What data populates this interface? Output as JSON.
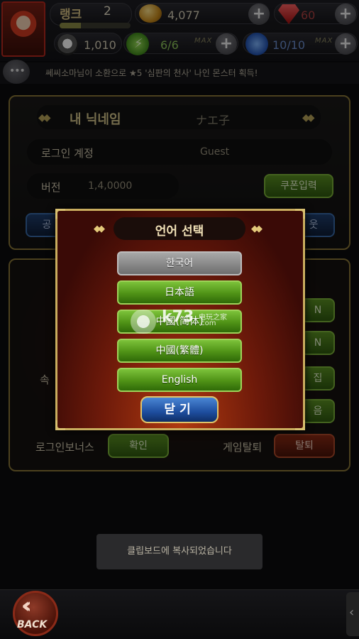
{
  "hud": {
    "rank_label": "랭크",
    "rank_value": "2",
    "xp_fraction": 0.3,
    "gold": "4,077",
    "gems": "60",
    "pet_count": "1,010",
    "energy": "6/6",
    "feathers": "10/10",
    "max_tag": "MAX",
    "plus": "+"
  },
  "ticker": {
    "text": "쎄씨소마님이 소환으로 ★5 '심판의 천사' 나인 몬스터 획득!"
  },
  "profile": {
    "nickname_label": "내 닉네임",
    "nickname_value": "ナエ子",
    "login_label": "로그인 계정",
    "login_value": "Guest",
    "version_label": "버전",
    "version_value": "1,4,0000",
    "coupon_button": "쿠폰입력",
    "left_partial_button": "공",
    "right_partial_button": "웃"
  },
  "settings": {
    "right_btn_1": "N",
    "right_btn_2": "N",
    "right_btn_3": "집",
    "right_btn_4": "음",
    "left_partial_label": "속",
    "login_bonus_label": "로그인보너스",
    "login_bonus_button": "확인",
    "withdraw_label": "게임탈퇴",
    "withdraw_button": "탈퇴"
  },
  "modal": {
    "title": "언어 선택",
    "languages": [
      {
        "label": "한국어",
        "selected": true
      },
      {
        "label": "日本語",
        "selected": false
      },
      {
        "label": "中國(简体)",
        "selected": false
      },
      {
        "label": "中國(繁體)",
        "selected": false
      },
      {
        "label": "English",
        "selected": false
      }
    ],
    "close_button": "닫기"
  },
  "watermark": {
    "brand": "k73",
    "tagline": "电玩之家",
    "domain": ".com"
  },
  "toast": {
    "text": "클립보드에 복사되었습니다"
  },
  "bottom": {
    "back_label": "BACK"
  },
  "colors": {
    "gold_border": "#c9ad5e",
    "green_button": "#4f9216",
    "selected_button": "#8a8a8a",
    "close_button": "#1d4d9e"
  }
}
